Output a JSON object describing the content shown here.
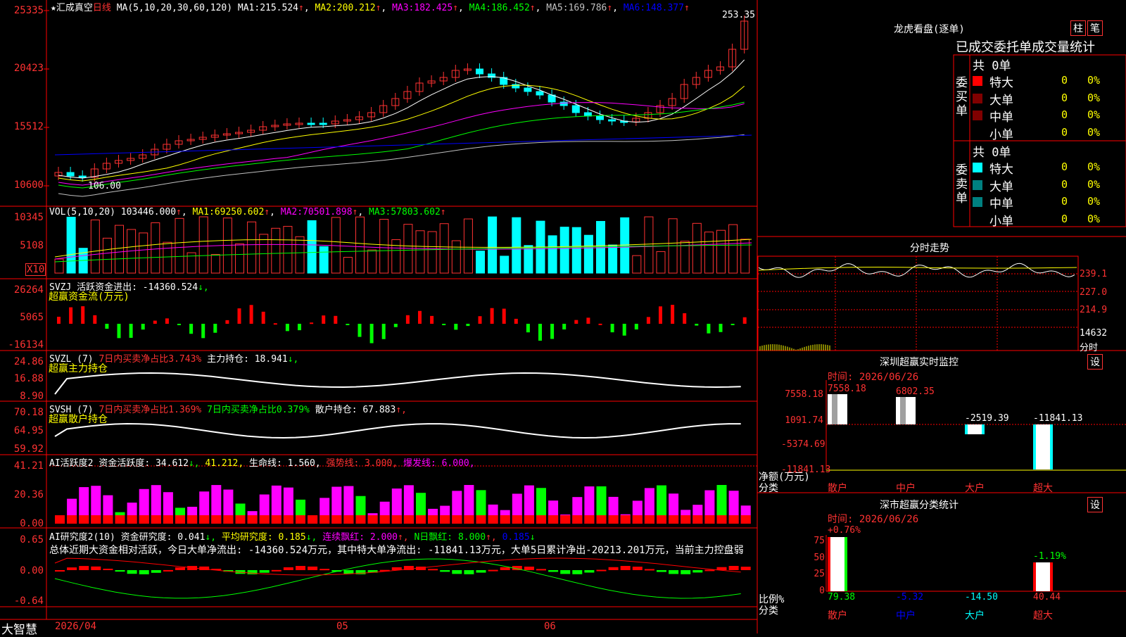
{
  "colors": {
    "up": "#ff3232",
    "down": "#00ffff",
    "grid": "#ff0000",
    "ma1": "#ffffff",
    "ma2": "#ffff00",
    "ma3": "#ff00ff",
    "ma4": "#00ff00",
    "ma5": "#c0c0c0",
    "ma6": "#0000ff"
  },
  "main": {
    "star": "★",
    "stock_name": "汇成真空",
    "period": "日线",
    "ma_label": "MA(5,10,20,30,60,120)",
    "ma": [
      {
        "label": "MA1:",
        "value": "215.524"
      },
      {
        "label": "MA2:",
        "value": "200.212"
      },
      {
        "label": "MA3:",
        "value": "182.425"
      },
      {
        "label": "MA4:",
        "value": "186.452"
      },
      {
        "label": "MA5:",
        "value": "169.786"
      },
      {
        "label": "MA6:",
        "value": "148.377"
      }
    ],
    "arrow": "↑",
    "y_ticks": [
      "25335",
      "20423",
      "15512",
      "10600"
    ],
    "high_mark": "253.35",
    "low_mark": "106.00"
  },
  "vol": {
    "label": "VOL(5,10,20)",
    "value": "103446.000",
    "ma": [
      {
        "label": "MA1:",
        "value": "69250.602"
      },
      {
        "label": "MA2:",
        "value": "70501.898"
      },
      {
        "label": "MA3:",
        "value": "57803.602"
      }
    ],
    "y_ticks": [
      "10345",
      "5108"
    ],
    "unit": "X10"
  },
  "svzj": {
    "label": "SVZJ",
    "desc": "活跃资金进出: -14360.524",
    "arrow": "↓,",
    "title": "超赢资金流(万元)",
    "y_ticks": [
      "26264",
      "5065",
      "-16134"
    ]
  },
  "svzl": {
    "label": "SVZL (7)",
    "desc": "7日内买卖净占比3.743%",
    "desc2": "主力持仓: 18.941",
    "arrow": "↓,",
    "title": "超赢主力持仓",
    "y_ticks": [
      "24.86",
      "16.88",
      "8.90"
    ]
  },
  "svsh": {
    "label": "SVSH (7)",
    "desc": "7日内买卖净占比1.369%",
    "desc2": "7日内买卖净占比0.379%",
    "desc3": "散户持仓: 67.883",
    "arrow": "↑,",
    "title": "超赢散户持仓",
    "y_ticks": [
      "70.18",
      "64.95",
      "59.92"
    ]
  },
  "ai1": {
    "label": "AI活跃度2",
    "desc": "资金活跃度: 34.612",
    "v2": "41.212,",
    "v3": "生命线: 1.560,",
    "v4": "强势线: 3.000,",
    "v5": "爆发线: 6.000,",
    "y_ticks": [
      "41.21",
      "20.36",
      "0.00"
    ]
  },
  "ai2": {
    "label": "AI研究度2(10)",
    "desc": "资金研究度: 0.041",
    "v2": "平均研究度: 0.185",
    "v3": "连续飘红: 2.000",
    "v4": "N日飘红: 8.000",
    "v5": "0.185",
    "summary": "总体近期大资金相对活跃，今日大单净流出: -14360.524万元，其中特大单净流出: -11841.13万元，大单5日累计净出-20213.201万元，当前主力控盘弱",
    "y_ticks": [
      "0.65",
      "0.00",
      "-0.64"
    ]
  },
  "bottom": {
    "brand": "大智慧",
    "dates": [
      "2026/04",
      "05",
      "06"
    ]
  },
  "lhb": {
    "title": "龙虎看盘(逐单)",
    "btn_pillar": "柱",
    "btn_pen": "笔",
    "header": "已成交委托单成交量统计",
    "buy_side": "委买单",
    "sell_side": "委卖单",
    "buy_total": "共 0单",
    "sell_total": "共 0单",
    "buy_rows": [
      {
        "name": "特大",
        "count": "0",
        "pct": "0%",
        "color": "#ff0000"
      },
      {
        "name": "大单",
        "count": "0",
        "pct": "0%",
        "color": "#800000"
      },
      {
        "name": "中单",
        "count": "0",
        "pct": "0%",
        "color": "#800000"
      },
      {
        "name": "小单",
        "count": "0",
        "pct": "0%",
        "color": "#000000"
      }
    ],
    "sell_rows": [
      {
        "name": "特大",
        "count": "0",
        "pct": "0%",
        "color": "#00ffff"
      },
      {
        "name": "大单",
        "count": "0",
        "pct": "0%",
        "color": "#008080"
      },
      {
        "name": "中单",
        "count": "0",
        "pct": "0%",
        "color": "#008080"
      },
      {
        "name": "小单",
        "count": "0",
        "pct": "0%",
        "color": "#000000"
      }
    ]
  },
  "intraday": {
    "title": "分时走势",
    "y_ticks": [
      "239.1",
      "227.0",
      "214.9"
    ],
    "vol_label": "14632",
    "vol_unit": "分时"
  },
  "monitor": {
    "title": "深圳超赢实时监控",
    "btn": "设",
    "time_label": "时间: 2026/06/26",
    "y_ticks": [
      "7558.18",
      "1091.74",
      "-5374.69",
      "-11841.13"
    ],
    "ylabel": "净额(万元)",
    "xlabel": "分类",
    "categories": [
      "散户",
      "中户",
      "大户",
      "超大"
    ],
    "values": [
      "7558.18",
      "6802.35",
      "-2519.39",
      "-11841.13"
    ]
  },
  "stats": {
    "title": "深市超赢分类统计",
    "btn": "设",
    "time_label": "时间: 2026/06/26",
    "y_ticks": [
      "75",
      "50",
      "25",
      "0"
    ],
    "ylabel": "比例%",
    "xlabel": "分类",
    "categories": [
      "散户",
      "中户",
      "大户",
      "超大"
    ],
    "values": [
      "79.38",
      "-5.32",
      "-14.50",
      "40.44"
    ],
    "top_labels": [
      "+0.76%",
      "-1.19%"
    ]
  }
}
